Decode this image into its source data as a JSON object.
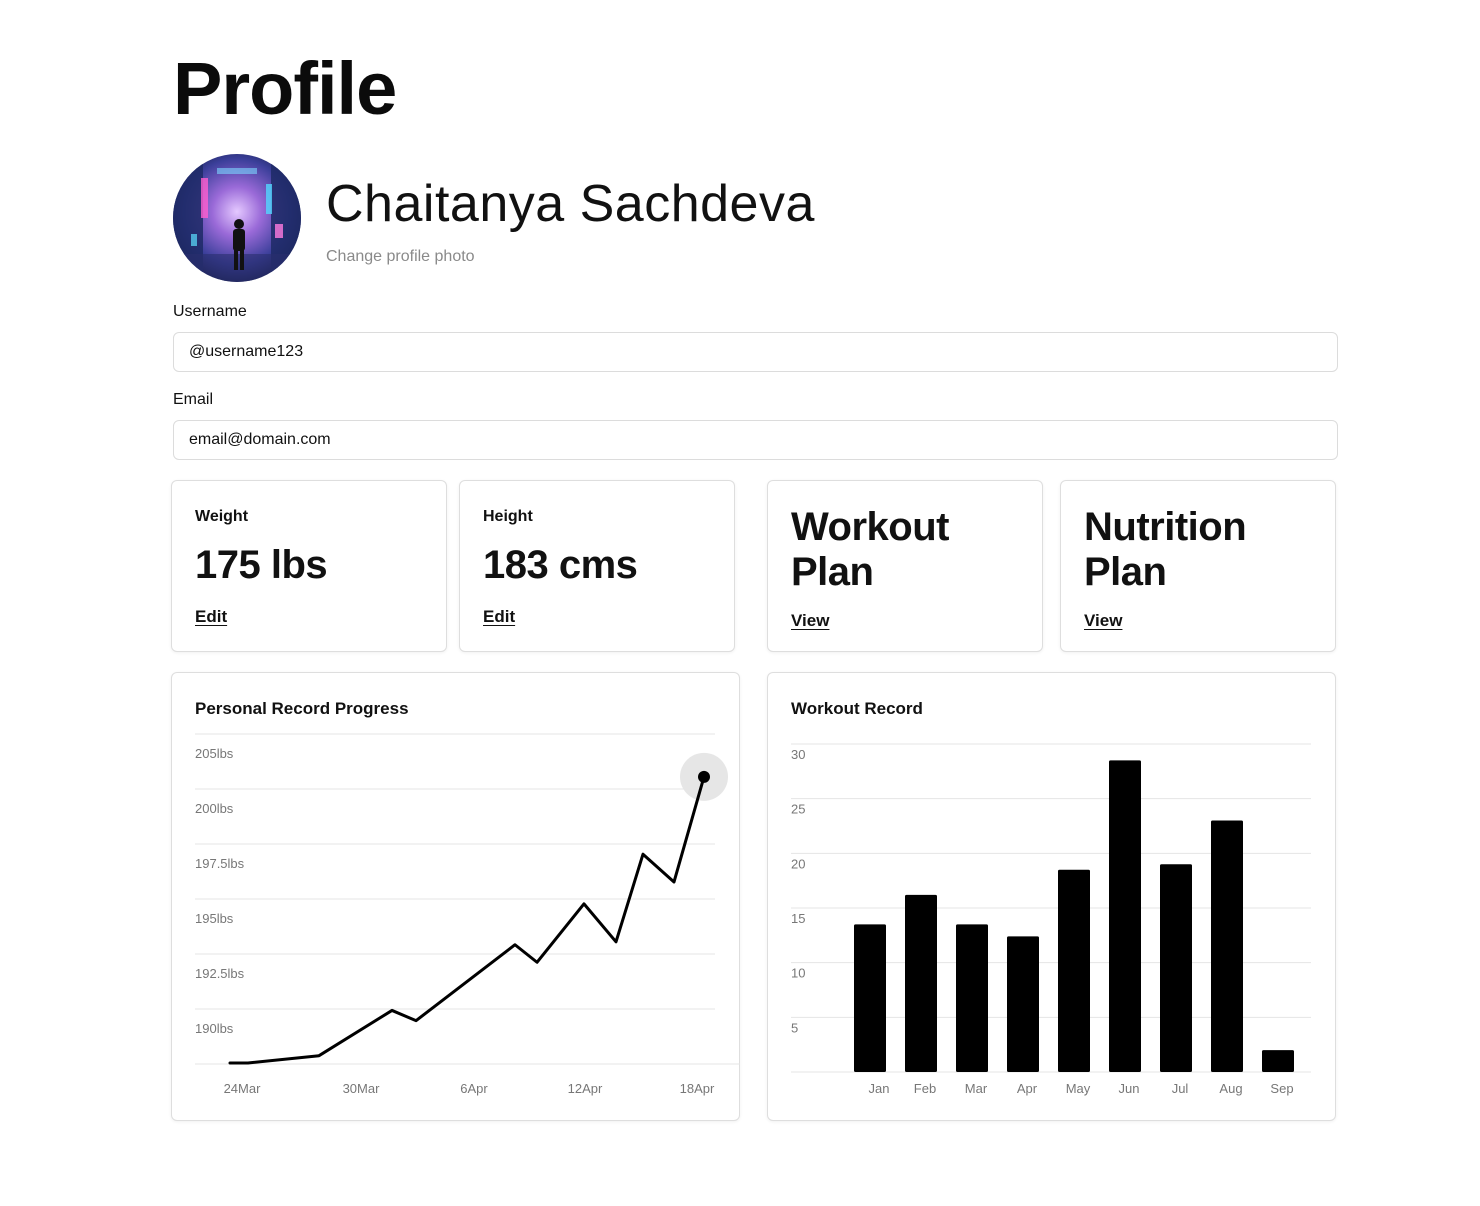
{
  "page": {
    "title": "Profile"
  },
  "profile": {
    "name": "Chaitanya Sachdeva",
    "change_photo_label": "Change profile photo"
  },
  "form": {
    "username": {
      "label": "Username",
      "value": "@username123"
    },
    "email": {
      "label": "Email",
      "value": "email@domain.com"
    }
  },
  "stats": {
    "weight": {
      "label": "Weight",
      "value": "175 lbs",
      "action": "Edit"
    },
    "height": {
      "label": "Height",
      "value": "183 cms",
      "action": "Edit"
    }
  },
  "plans": {
    "workout": {
      "title_line1": "Workout",
      "title_line2": "Plan",
      "action": "View"
    },
    "nutrition": {
      "title_line1": "Nutrition",
      "title_line2": "Plan",
      "action": "View"
    }
  },
  "chart_data": [
    {
      "type": "line",
      "title": "Personal Record Progress",
      "y_tick_labels": [
        "190lbs",
        "192.5lbs",
        "195lbs",
        "197.5lbs",
        "200lbs",
        "205lbs"
      ],
      "x_tick_labels": [
        "24Mar",
        "30Mar",
        "6Apr",
        "12Apr",
        "18Apr"
      ],
      "series": [
        {
          "y_level": [
            0,
            0,
            0.5,
            3.6,
            2.9,
            8.1,
            6.9,
            10.9,
            8.3,
            14.3,
            12.4,
            19.6
          ]
        }
      ],
      "x": [
        "24Mar",
        "25Mar",
        "28Mar",
        "31Mar",
        "1Apr",
        "6Apr",
        "7Apr",
        "10Apr",
        "11Apr",
        "14Apr",
        "16Apr",
        "18Apr"
      ],
      "highlight_last_point": true,
      "color": "#000000",
      "grid": true
    },
    {
      "type": "bar",
      "title": "Workout Record",
      "categories": [
        "Jan",
        "Feb",
        "Mar",
        "Apr",
        "May",
        "Jun",
        "Jul",
        "Aug",
        "Sep"
      ],
      "values": [
        13.5,
        16.2,
        13.5,
        12.4,
        18.5,
        28.5,
        19.0,
        23.0,
        2.0
      ],
      "y_ticks": [
        5,
        10,
        15,
        20,
        25,
        30
      ],
      "ylim": [
        0,
        30
      ],
      "color": "#000000",
      "grid": true
    }
  ]
}
